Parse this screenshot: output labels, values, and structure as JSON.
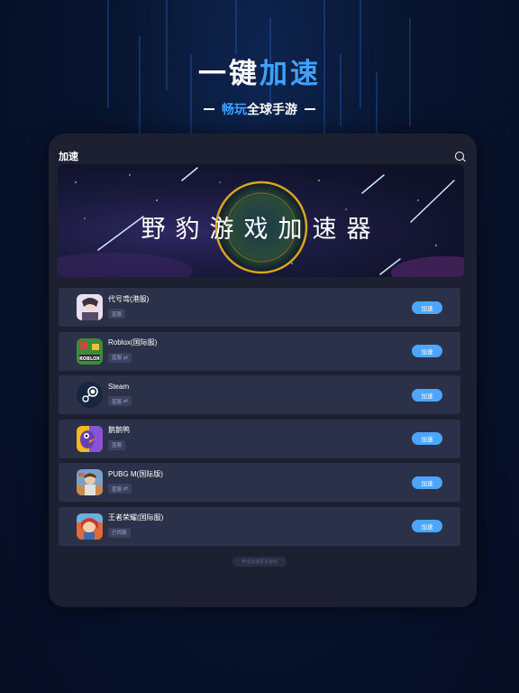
{
  "hero": {
    "title_plain": "一键",
    "title_highlight": "加速",
    "subtitle_highlight": "畅玩",
    "subtitle_plain": "全球手游"
  },
  "header": {
    "title": "加速",
    "search_icon": "search-icon"
  },
  "banner": {
    "text": "野豹游戏加速器"
  },
  "games": [
    {
      "name": "代号鸢(港服)",
      "region": "蓝服",
      "swap": false,
      "icon": "anime-portrait-icon",
      "button": "加速"
    },
    {
      "name": "Roblox(国际服)",
      "region": "蓝服",
      "swap": true,
      "icon": "roblox-icon",
      "button": "加速"
    },
    {
      "name": "Steam",
      "region": "蓝服",
      "swap": true,
      "icon": "steam-icon",
      "button": "加速"
    },
    {
      "name": "鹅鹅鸭",
      "region": "蓝服",
      "swap": false,
      "icon": "goose-duck-icon",
      "button": "加速"
    },
    {
      "name": "PUBG M(国际版)",
      "region": "蓝服",
      "swap": true,
      "icon": "pubg-icon",
      "button": "加速"
    },
    {
      "name": "王者荣耀(国际服)",
      "region": "巴西服",
      "swap": false,
      "icon": "honor-of-kings-icon",
      "button": "加速"
    }
  ],
  "footer": {
    "label": "申请加速更多游戏"
  },
  "colors": {
    "accent": "#3ea2ff",
    "button": "#4ca6ff",
    "card": "#2b3148",
    "device": "#1d2030"
  }
}
